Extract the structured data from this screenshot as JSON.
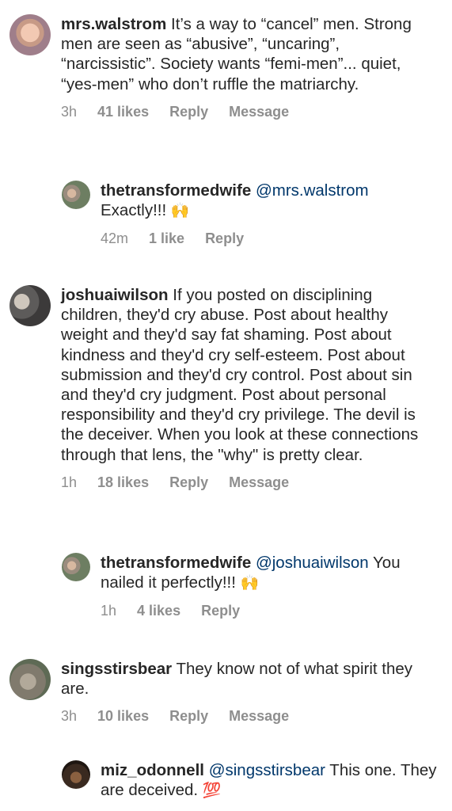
{
  "comments": [
    {
      "username": "mrs.walstrom",
      "text": "It’s a way to “cancel” men. Strong men are seen as “abusive”, “uncaring”, “narcissistic”. Society wants “femi-men”... quiet, “yes-men” who don’t ruffle the matriarchy.",
      "time": "3h",
      "likes": "41 likes",
      "reply": "Reply",
      "message": "Message"
    },
    {
      "username": "thetransformedwife",
      "mention": "@mrs.walstrom",
      "text": "Exactly!!!",
      "emoji": "🙌",
      "time": "42m",
      "likes": "1 like",
      "reply": "Reply"
    },
    {
      "username": "joshuaiwilson",
      "text": "If you posted on disciplining children, they'd cry abuse. Post about healthy weight and they'd say fat shaming. Post about kindness and they'd cry self-esteem. Post about submission and they'd cry control. Post about sin and they'd cry judgment. Post about personal responsibility and they'd cry privilege. The devil is the deceiver. When you look at these connections through that lens, the \"why\" is pretty clear.",
      "time": "1h",
      "likes": "18 likes",
      "reply": "Reply",
      "message": "Message"
    },
    {
      "username": "thetransformedwife",
      "mention": "@joshuaiwilson",
      "text": "You nailed it perfectly!!!",
      "emoji": "🙌",
      "time": "1h",
      "likes": "4 likes",
      "reply": "Reply"
    },
    {
      "username": "singsstirsbear",
      "text": "They know not of what spirit they are.",
      "time": "3h",
      "likes": "10 likes",
      "reply": "Reply",
      "message": "Message"
    },
    {
      "username": "miz_odonnell",
      "mention": "@singsstirsbear",
      "text": "This one. They are deceived.",
      "emoji": "💯"
    }
  ]
}
